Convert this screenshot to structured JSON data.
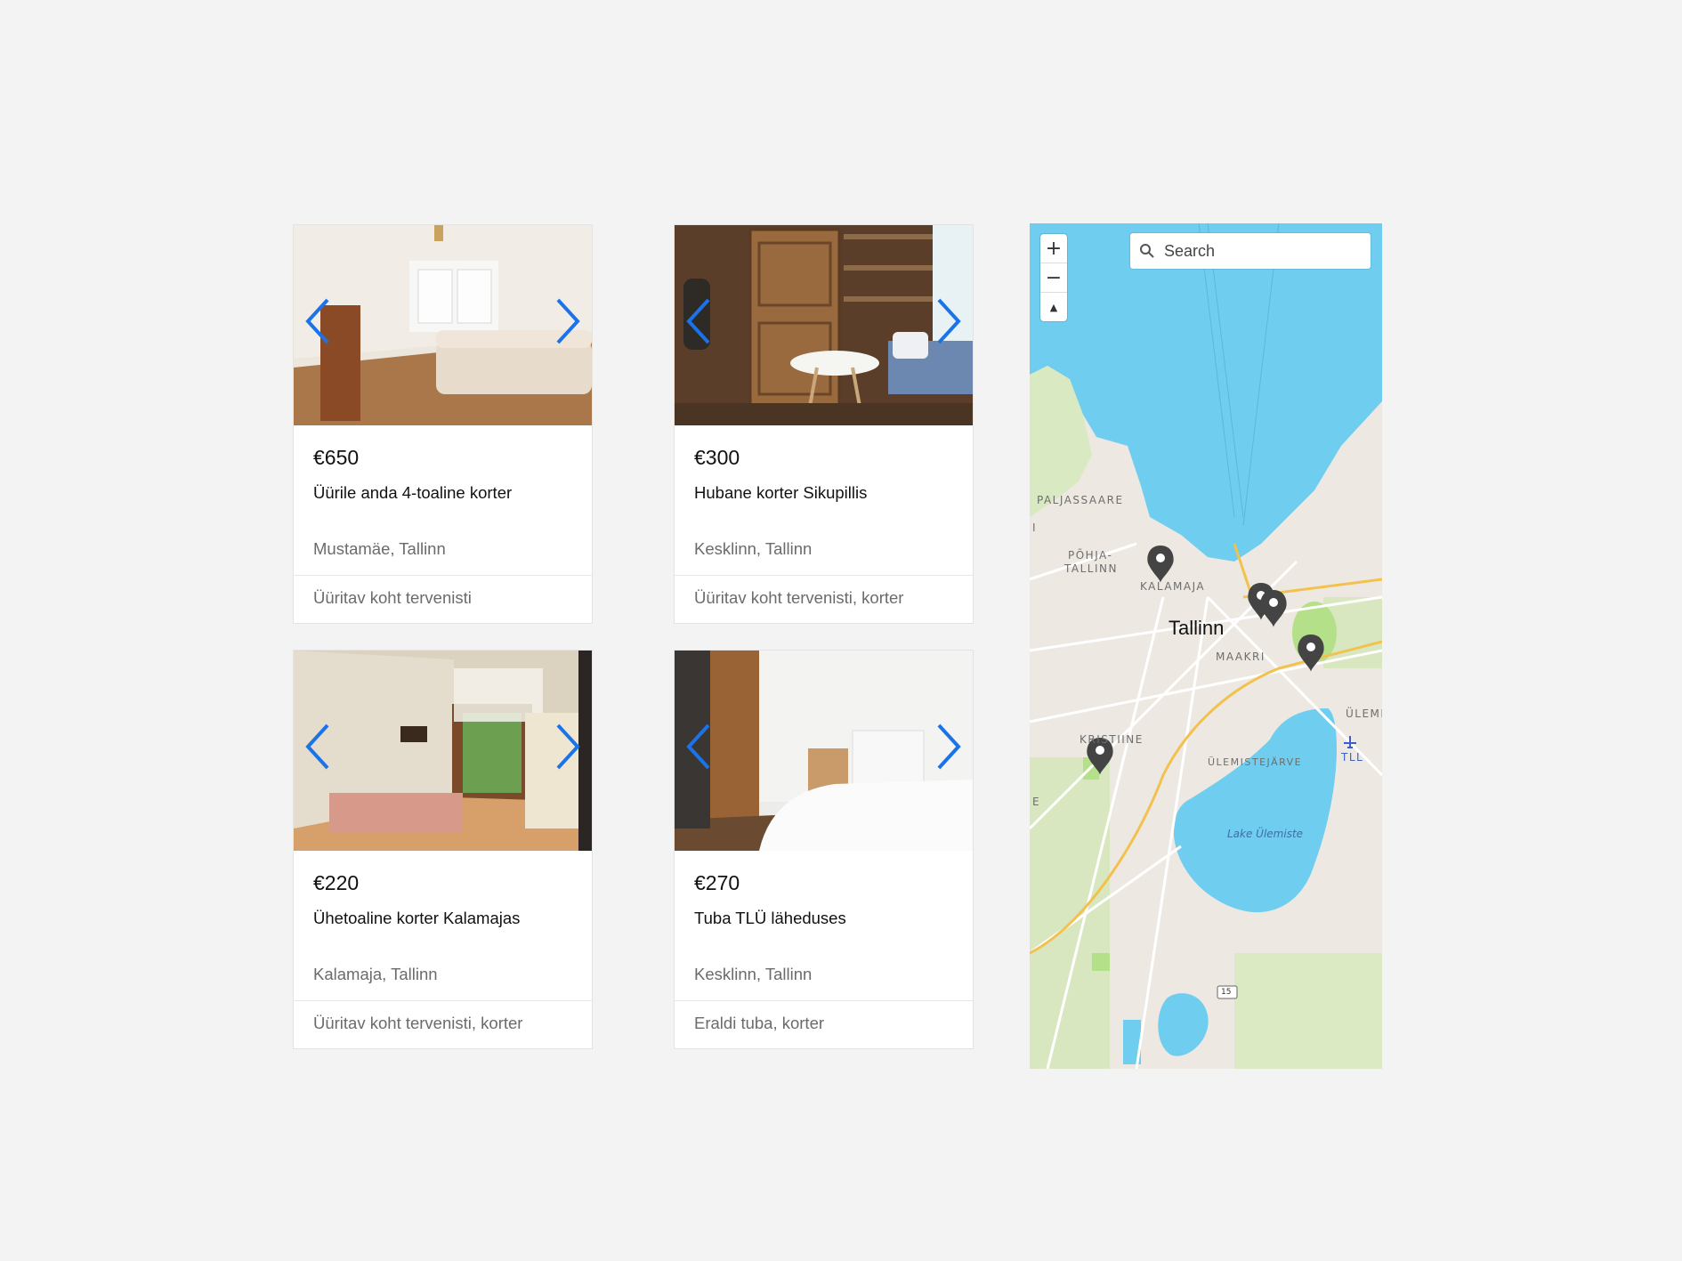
{
  "listings": [
    {
      "price": "€650",
      "title": "Üürile anda 4-toaline korter",
      "location": "Mustamäe, Tallinn",
      "type": "Üüritav koht tervenisti"
    },
    {
      "price": "€300",
      "title": "Hubane korter Sikupillis",
      "location": "Kesklinn, Tallinn",
      "type": "Üüritav koht tervenisti, korter"
    },
    {
      "price": "€220",
      "title": "Ühetoaline korter Kalamajas",
      "location": "Kalamaja, Tallinn",
      "type": "Üüritav koht tervenisti, korter"
    },
    {
      "price": "€270",
      "title": "Tuba TLÜ läheduses",
      "location": "Kesklinn, Tallinn",
      "type": "Eraldi tuba, korter"
    }
  ],
  "map": {
    "search_placeholder": "Search",
    "zoom_in": "+",
    "zoom_out": "−",
    "compass": "▲",
    "labels": {
      "paljassaare": "PALJASSAARE",
      "pohja1": "PÕHJA-",
      "pohja2": "TALLINN",
      "kalamaja": "KALAMAJA",
      "tallinn": "Tallinn",
      "maakri": "MAAKRI",
      "kristiine": "KRISTIINE",
      "ulemistejarve": "ÜLEMISTEJÄRVE",
      "ulem": "ÜLEMI",
      "tll": "TLL",
      "lake": "Lake Ülemiste",
      "road15": "15",
      "edge_i": "I",
      "edge_e": "E"
    }
  },
  "colors": {
    "accent": "#1a73e8",
    "land": "#ede9e2",
    "water": "#6fcdf0",
    "park": "#b5e08a",
    "road": "#f2c14e"
  }
}
